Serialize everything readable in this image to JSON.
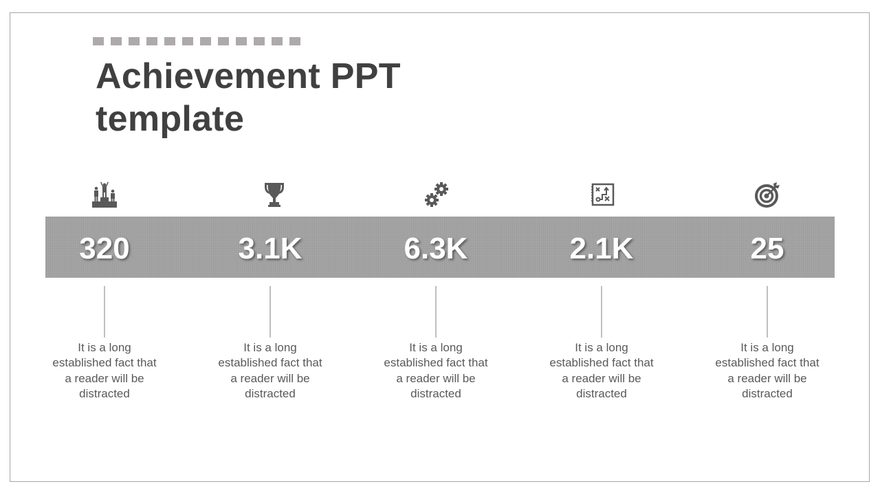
{
  "slide": {
    "title": "Achievement PPT template",
    "decor_dash_count": 12,
    "colors": {
      "title": "#404040",
      "band": "#a5a5a5",
      "dash": "#aeaaaa",
      "icon": "#595959",
      "description": "#595959",
      "value": "#ffffff"
    },
    "stats": [
      {
        "icon": "podium-winners-icon",
        "value": "320",
        "description": "It is a long established fact that a reader will be distracted"
      },
      {
        "icon": "trophy-icon",
        "value": "3.1K",
        "description": "It is a long established fact that a reader will be distracted"
      },
      {
        "icon": "gears-icon",
        "value": "6.3K",
        "description": "It is a long established fact that a reader will be distracted"
      },
      {
        "icon": "strategy-board-icon",
        "value": "2.1K",
        "description": "It is a long established fact that a reader will be distracted"
      },
      {
        "icon": "target-icon",
        "value": "25",
        "description": "It is a long established fact that a reader will be distracted"
      }
    ]
  }
}
